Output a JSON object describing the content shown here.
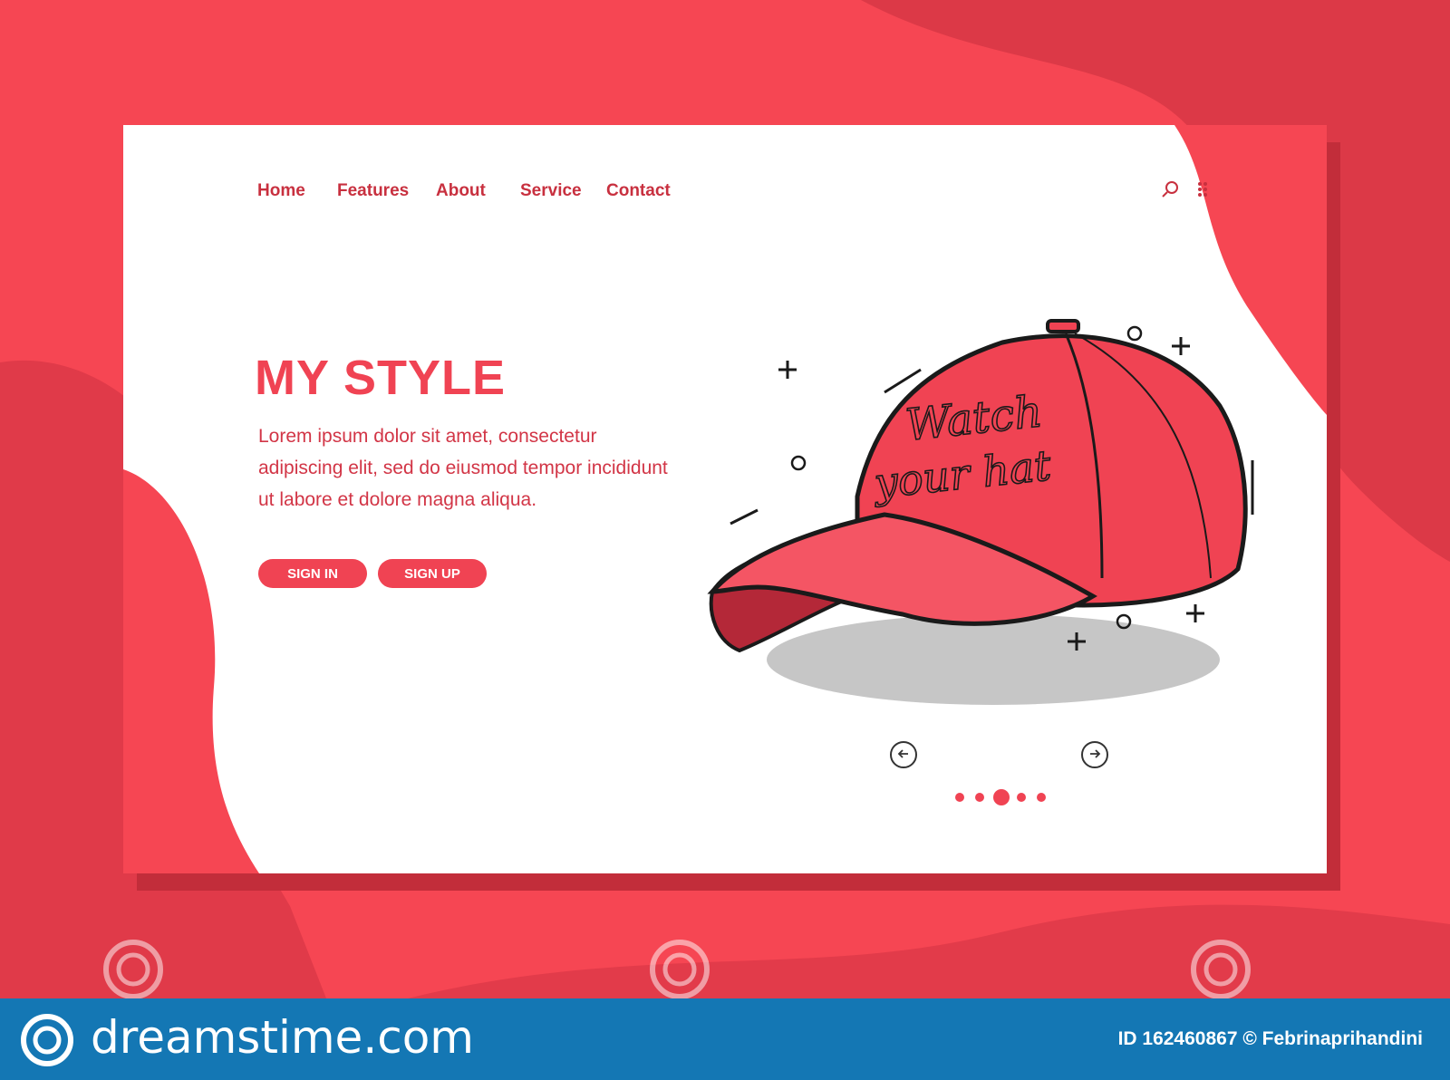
{
  "nav": {
    "links": [
      "Home",
      "Features",
      "About",
      "Service",
      "Contact"
    ],
    "icons": [
      "search-icon",
      "grid-menu-icon"
    ]
  },
  "hero": {
    "title": "MY STYLE",
    "text": "Lorem ipsum dolor sit amet, consectetur adipiscing elit, sed do eiusmod tempor incididunt ut labore et dolore magna aliqua.",
    "buttons": [
      "SIGN IN",
      "SIGN UP"
    ]
  },
  "illustration": {
    "subject": "baseball-cap",
    "cap_text": [
      "Watch",
      "your hat"
    ]
  },
  "carousel": {
    "prev_icon": "arrow-left-icon",
    "next_icon": "arrow-right-icon",
    "slide_count": 5,
    "active_slide": 3
  },
  "watermark": {
    "brand": "dreamstime.com",
    "credit": "ID 162460867 © Febrinaprihandini"
  },
  "colors": {
    "accent": "#f04353",
    "background": "#f64653",
    "text": "#c8303f",
    "footer": "#1477b4"
  }
}
